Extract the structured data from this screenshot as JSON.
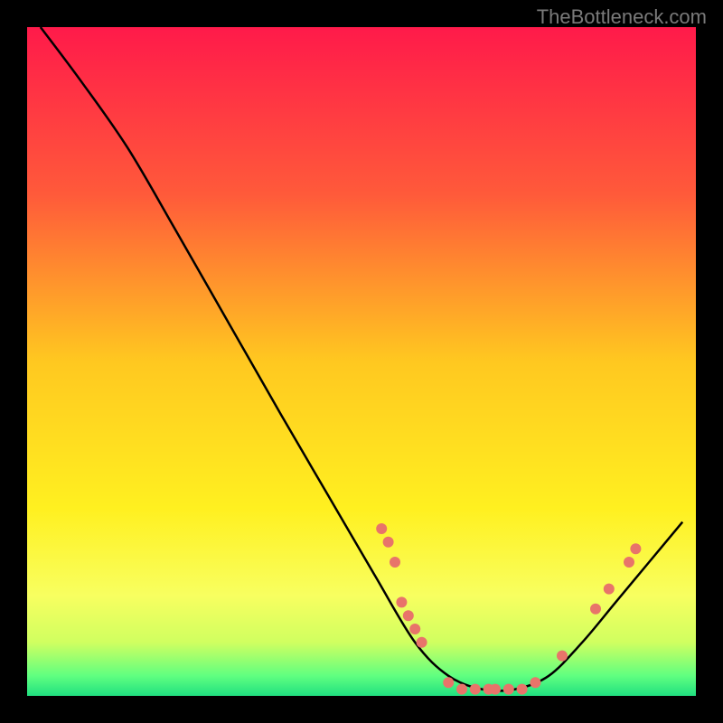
{
  "watermark": "TheBottleneck.com",
  "chart_data": {
    "type": "line",
    "title": "",
    "xlabel": "",
    "ylabel": "",
    "xlim": [
      0,
      100
    ],
    "ylim": [
      0,
      100
    ],
    "gradient_stops": [
      {
        "offset": 0,
        "color": "#ff1a4a"
      },
      {
        "offset": 0.25,
        "color": "#ff5a3a"
      },
      {
        "offset": 0.5,
        "color": "#ffc820"
      },
      {
        "offset": 0.72,
        "color": "#fff020"
      },
      {
        "offset": 0.85,
        "color": "#f8ff60"
      },
      {
        "offset": 0.92,
        "color": "#d0ff60"
      },
      {
        "offset": 0.97,
        "color": "#60ff80"
      },
      {
        "offset": 1.0,
        "color": "#20e080"
      }
    ],
    "curve": [
      {
        "x": 2,
        "y": 100
      },
      {
        "x": 8,
        "y": 92
      },
      {
        "x": 15,
        "y": 82
      },
      {
        "x": 22,
        "y": 70
      },
      {
        "x": 30,
        "y": 56
      },
      {
        "x": 38,
        "y": 42
      },
      {
        "x": 45,
        "y": 30
      },
      {
        "x": 52,
        "y": 18
      },
      {
        "x": 58,
        "y": 8
      },
      {
        "x": 63,
        "y": 3
      },
      {
        "x": 68,
        "y": 1
      },
      {
        "x": 73,
        "y": 1
      },
      {
        "x": 78,
        "y": 3
      },
      {
        "x": 83,
        "y": 8
      },
      {
        "x": 88,
        "y": 14
      },
      {
        "x": 93,
        "y": 20
      },
      {
        "x": 98,
        "y": 26
      }
    ],
    "markers": [
      {
        "x": 53,
        "y": 25
      },
      {
        "x": 54,
        "y": 23
      },
      {
        "x": 55,
        "y": 20
      },
      {
        "x": 56,
        "y": 14
      },
      {
        "x": 57,
        "y": 12
      },
      {
        "x": 58,
        "y": 10
      },
      {
        "x": 59,
        "y": 8
      },
      {
        "x": 63,
        "y": 2
      },
      {
        "x": 65,
        "y": 1
      },
      {
        "x": 67,
        "y": 1
      },
      {
        "x": 69,
        "y": 1
      },
      {
        "x": 70,
        "y": 1
      },
      {
        "x": 72,
        "y": 1
      },
      {
        "x": 74,
        "y": 1
      },
      {
        "x": 76,
        "y": 2
      },
      {
        "x": 80,
        "y": 6
      },
      {
        "x": 85,
        "y": 13
      },
      {
        "x": 87,
        "y": 16
      },
      {
        "x": 90,
        "y": 20
      },
      {
        "x": 91,
        "y": 22
      }
    ],
    "marker_color": "#e8746a",
    "curve_color": "#000000"
  }
}
